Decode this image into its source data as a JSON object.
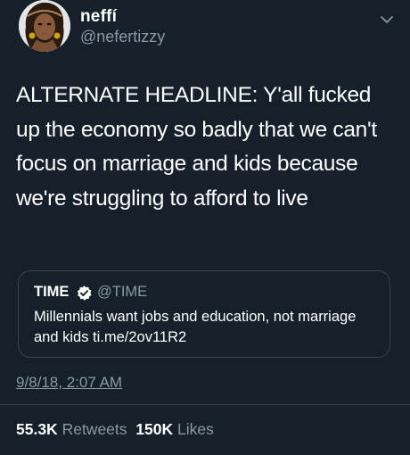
{
  "author": {
    "display_name": "neffí",
    "handle": "@nefertizzy",
    "avatar_icon": "avatar-portrait"
  },
  "tweet": {
    "text": "ALTERNATE HEADLINE: Y'all fucked up the economy so badly that we can't focus on marriage and kids because we're struggling to afford to live"
  },
  "quoted_tweet": {
    "name": "TIME",
    "verified_icon": "verified-badge-icon",
    "handle": "@TIME",
    "text": "Millennials want jobs and education, not marriage and kids ti.me/2ov11R2"
  },
  "meta": {
    "timestamp": "9/8/18, 2:07 AM"
  },
  "stats": {
    "retweets_count": "55.3K",
    "retweets_label": "Retweets",
    "likes_count": "150K",
    "likes_label": "Likes"
  },
  "colors": {
    "background": "#15202b",
    "text": "#ffffff",
    "secondary_text": "#8899a6",
    "border": "#38444d",
    "verified": "#1da1f2"
  }
}
